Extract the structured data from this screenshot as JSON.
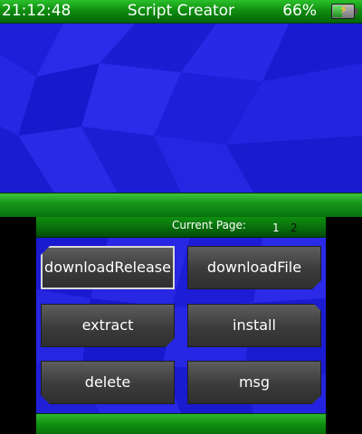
{
  "status_bar": {
    "time": "21:12:48",
    "title": "Script Creator",
    "battery_percent": "66%",
    "battery_icon": "battery-charging-icon"
  },
  "pager": {
    "label": "Current Page:",
    "pages": [
      "1",
      "2"
    ],
    "current_page": 1
  },
  "buttons": {
    "download_release": "downloadRelease",
    "download_file": "downloadFile",
    "extract": "extract",
    "install": "install",
    "delete": "delete",
    "msg": "msg"
  },
  "colors": {
    "accent_green": "#0f8f10",
    "background_blue": "#2222e0",
    "button_gray": "#474747"
  }
}
